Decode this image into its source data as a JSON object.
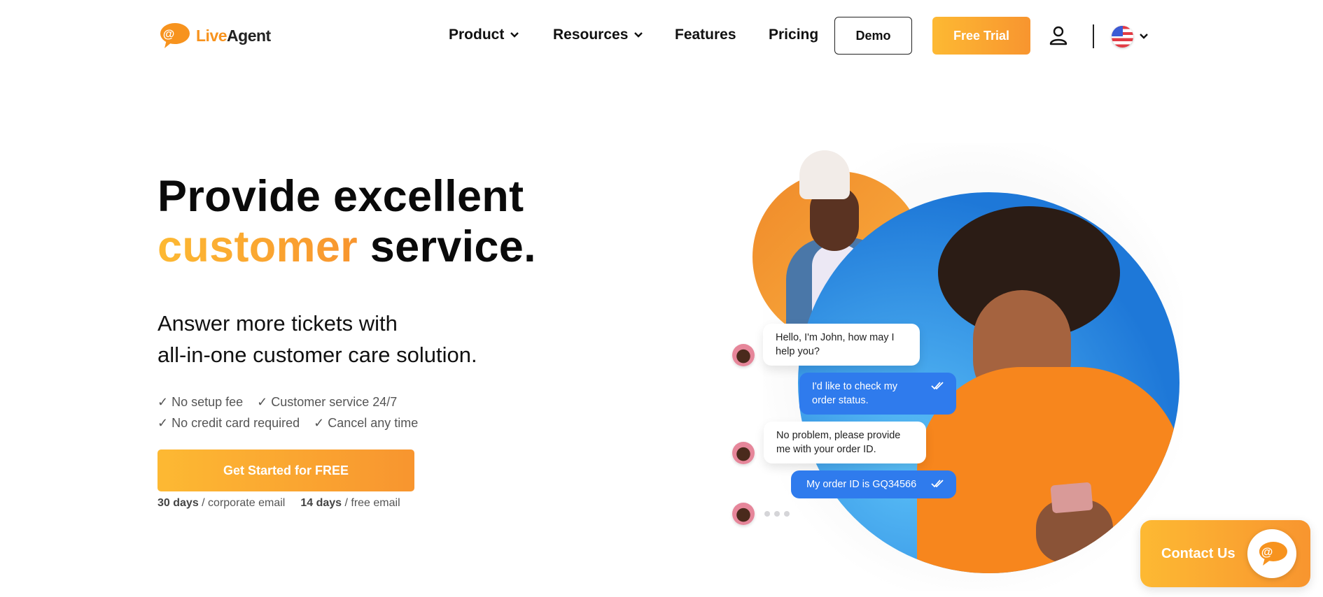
{
  "brand": {
    "name_part1": "Live",
    "name_part2": "Agent",
    "accent_color": "#f7931e",
    "gradient_start": "#fdb933",
    "gradient_end": "#f8952f"
  },
  "nav": {
    "items": [
      {
        "label": "Product",
        "has_dropdown": true
      },
      {
        "label": "Resources",
        "has_dropdown": true
      },
      {
        "label": "Features",
        "has_dropdown": false
      },
      {
        "label": "Pricing",
        "has_dropdown": false
      }
    ],
    "demo_label": "Demo",
    "free_trial_label": "Free Trial",
    "account_icon": "user-icon",
    "language_icon": "us-flag-icon"
  },
  "hero": {
    "headline_line1": "Provide excellent",
    "headline_accent": "customer",
    "headline_rest": " service.",
    "subtitle_line1": "Answer more tickets with",
    "subtitle_line2": "all-in-one customer care solution.",
    "checks": [
      [
        "✓ No setup fee",
        "✓ Customer service 24/7"
      ],
      [
        "✓ No credit card required",
        "✓ Cancel any time"
      ]
    ],
    "cta_label": "Get Started for FREE",
    "trial_notes": [
      {
        "bold": "30 days",
        "text": " / corporate email"
      },
      {
        "bold": "14 days",
        "text": " / free email"
      }
    ]
  },
  "chat": {
    "messages": [
      {
        "from": "agent",
        "text": "Hello, I'm John, how may I help you?"
      },
      {
        "from": "customer",
        "text": "I'd like to check my order status.",
        "status": "read"
      },
      {
        "from": "agent",
        "text": "No problem, please provide me with your order ID."
      },
      {
        "from": "customer",
        "text": "My order ID is GQ34566",
        "status": "read"
      }
    ],
    "typing": true,
    "customer_bubble_color": "#2f7bed"
  },
  "contact_widget": {
    "label": "Contact Us",
    "icon": "chat-at-icon"
  }
}
